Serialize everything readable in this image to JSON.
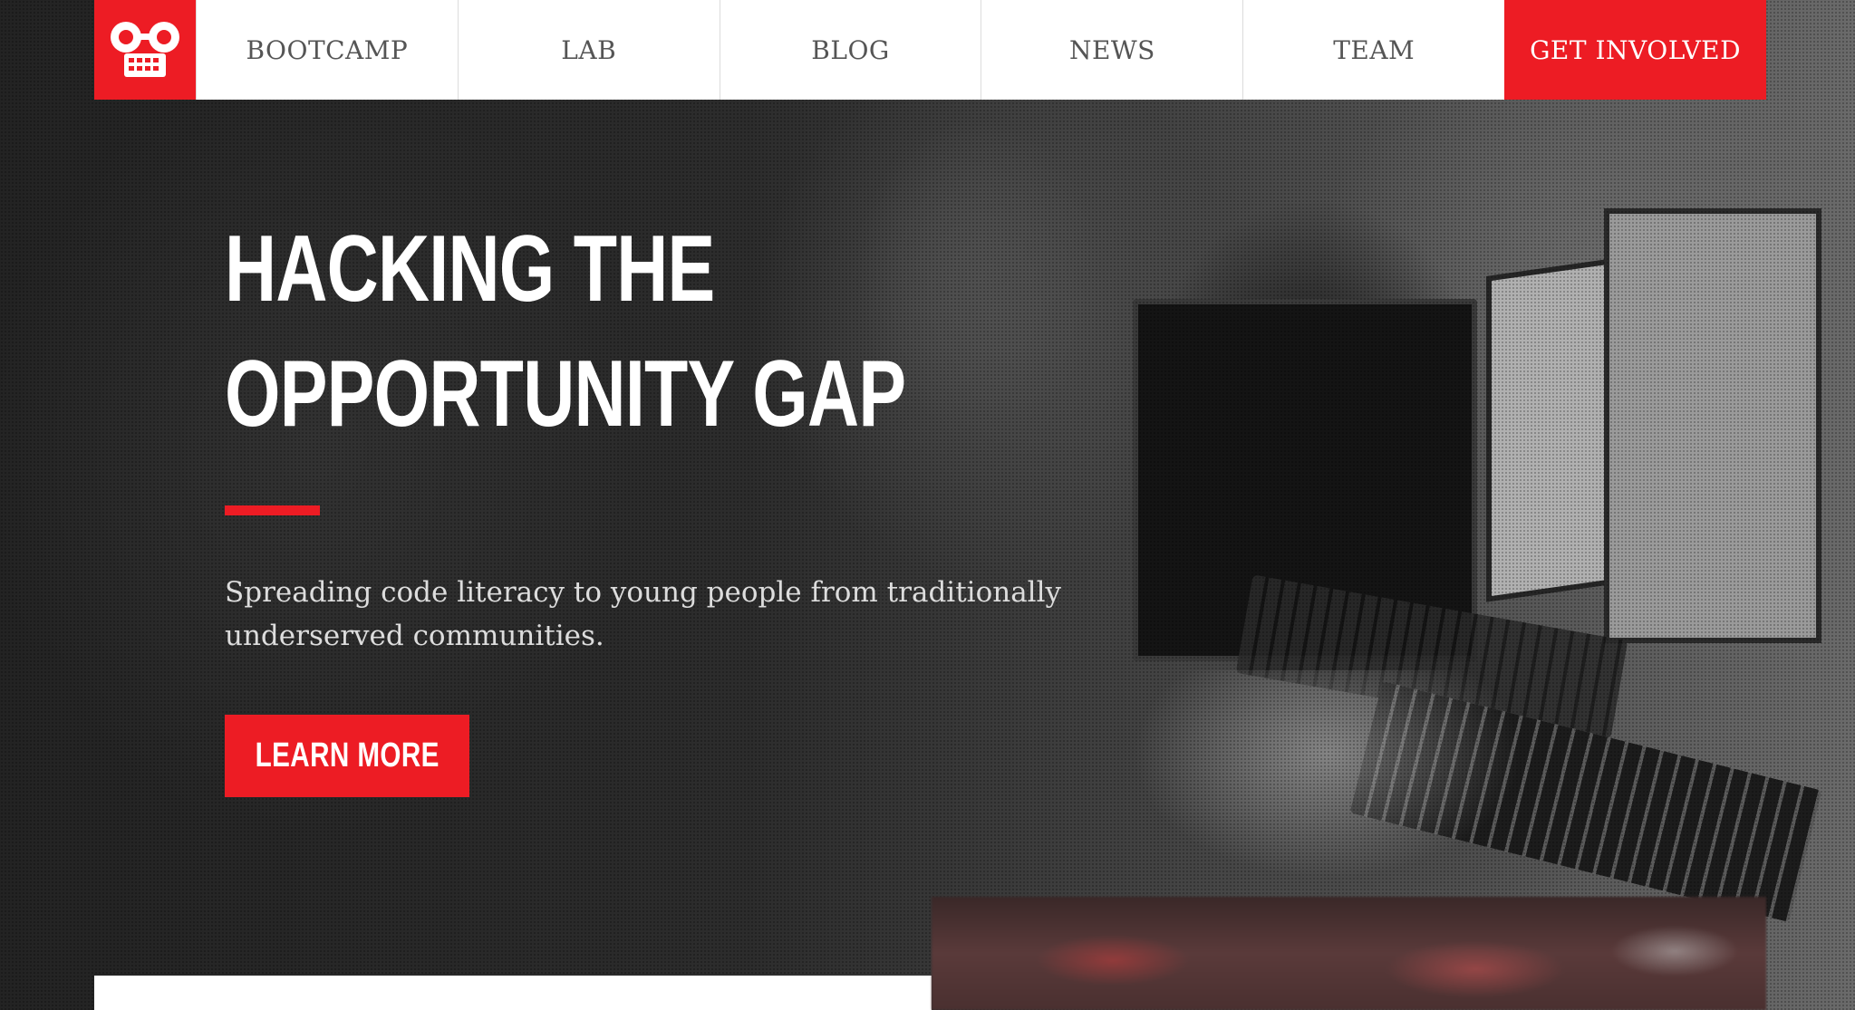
{
  "nav": {
    "logo_alt": "robot-logo",
    "items": [
      {
        "label": "BOOTCAMP"
      },
      {
        "label": "LAB"
      },
      {
        "label": "BLOG"
      },
      {
        "label": "NEWS"
      },
      {
        "label": "TEAM"
      }
    ],
    "cta_label": "GET INVOLVED"
  },
  "hero": {
    "title_line1": "HACKING THE",
    "title_line2": "OPPORTUNITY GAP",
    "subtitle_line1": "Spreading code literacy to young people from traditionally",
    "subtitle_line2": "underserved communities.",
    "button_label": "LEARN MORE"
  },
  "colors": {
    "brand_red": "#ed1c24",
    "nav_bg": "#ffffff",
    "nav_text": "#555555",
    "hero_text": "#ffffff"
  },
  "icons": {
    "logo": "robot-icon"
  }
}
